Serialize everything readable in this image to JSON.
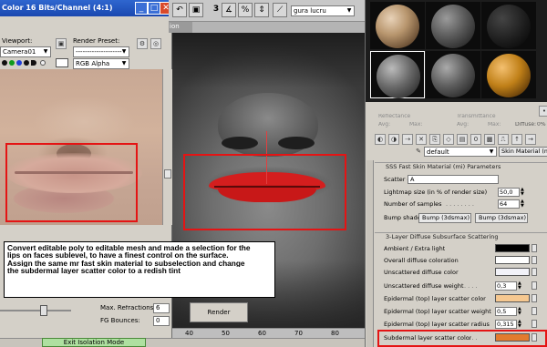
{
  "render_frame": {
    "title": "Color 16 Bits/Channel (4:1)",
    "viewport_label": "Viewport:",
    "viewport_value": "Camera01",
    "render_preset_label": "Render Preset:",
    "render_preset_value": "--------------------",
    "channel_value": "RGB Alpha",
    "max_refractions_label": "Max. Refractions:",
    "max_refractions_value": "6",
    "fg_bounces_label": "FG Bounces:",
    "fg_bounces_value": "0",
    "render_button": "Render",
    "exit_isolation": "Exit Isolation Mode"
  },
  "toolbar": {
    "three_label": "3",
    "named_selection": "gura lucru"
  },
  "viewport": {
    "tab_label": "ion",
    "ruler_ticks": [
      "40",
      "50",
      "60",
      "70",
      "80"
    ]
  },
  "material_editor": {
    "reflectance_label": "Reflectance",
    "transmittance_label": "Transmittance",
    "avg_label_1": "Avg:",
    "max_label_1": "Max:",
    "avg_label_2": "Avg:",
    "max_label_2": "Max:",
    "diffuse_label": "Diffuse:",
    "diffuse_value": "0%",
    "material_name": "default",
    "material_type": "Skin Material (m)",
    "params_title": "SSS Fast Skin Material (mi) Parameters",
    "scatter_group_label": "Scatter grou...",
    "scatter_group_value": "A",
    "lightmap_label": "Lightmap size (in % of render size)",
    "lightmap_value": "50,0",
    "samples_label": "Number of samples",
    "samples_value": "64",
    "bump_label": "Bump shader .",
    "bump_button_1": "Bump (3dsmax)",
    "bump_button_2": "Bump (3dsmax)",
    "layer_title": "3-Layer Diffuse Subsurface Scattering",
    "rows": [
      {
        "label": "Ambient / Extra light",
        "kind": "swatch",
        "color": "#000000"
      },
      {
        "label": "Overall diffuse coloration",
        "kind": "swatch",
        "color": "#ffffff"
      },
      {
        "label": "Unscattered diffuse color",
        "kind": "swatch",
        "color": "#f2f2f8"
      },
      {
        "label": "Unscattered diffuse weight",
        "kind": "value",
        "value": "0,3"
      },
      {
        "label": "Epidermal (top) layer scatter color",
        "kind": "swatch",
        "color": "#f6c890"
      },
      {
        "label": "Epidermal (top) layer scatter weight",
        "kind": "value",
        "value": "0,5"
      },
      {
        "label": "Epidermal (top) layer scatter radius",
        "kind": "value",
        "value": "0,315"
      },
      {
        "label": "Subdermal layer scatter color",
        "kind": "swatch",
        "color": "#e27b2e"
      }
    ]
  },
  "caption": {
    "line1": "Convert editable poly to editable mesh and made a selection for the",
    "line2": "lips on faces sublevel, to have a finest control on the surface.",
    "line3": "Assign the same mr fast skin material to subselection and change",
    "line4": "the subdermal layer scatter color to a redish tint"
  },
  "colors": {
    "highlight": "#e41414",
    "lip_selection": "#d41e1e",
    "subdermal_color": "#e27b2e"
  }
}
